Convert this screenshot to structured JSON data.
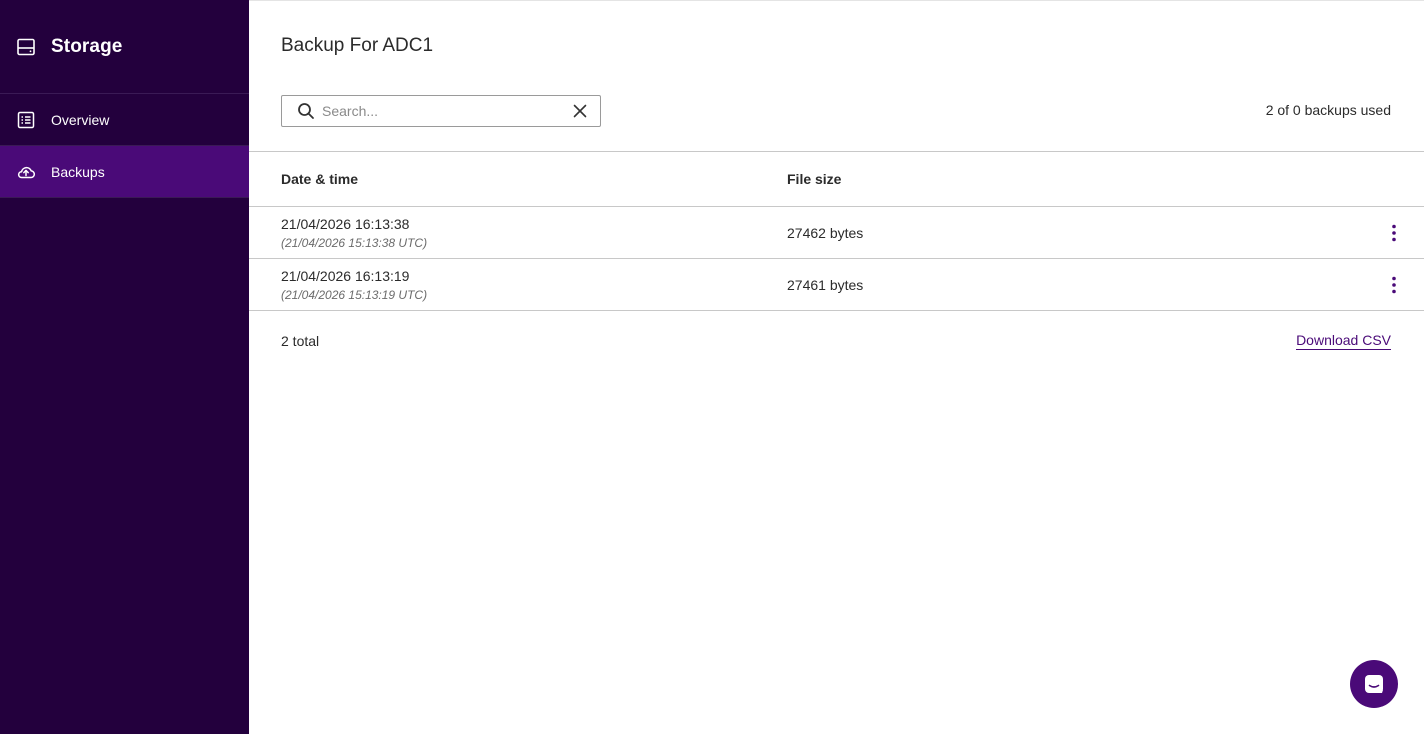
{
  "sidebar": {
    "title": "Storage",
    "title_icon": "storage-drive-icon",
    "items": [
      {
        "label": "Overview",
        "icon": "list-icon",
        "active": false
      },
      {
        "label": "Backups",
        "icon": "cloud-upload-icon",
        "active": true
      }
    ]
  },
  "main": {
    "title": "Backup For ADC1",
    "search": {
      "placeholder": "Search...",
      "value": ""
    },
    "usage_text": "2 of 0 backups used",
    "table": {
      "headers": {
        "date": "Date & time",
        "size": "File size"
      },
      "rows": [
        {
          "date": "21/04/2026 16:13:38",
          "utc": "(21/04/2026 15:13:38 UTC)",
          "size": "27462 bytes"
        },
        {
          "date": "21/04/2026 16:13:19",
          "utc": "(21/04/2026 15:13:19 UTC)",
          "size": "27461 bytes"
        }
      ]
    },
    "footer": {
      "total": "2 total",
      "download_label": "Download CSV"
    }
  },
  "colors": {
    "sidebar_bg": "#23003d",
    "sidebar_active": "#4a0a78",
    "accent": "#4a0a78"
  }
}
